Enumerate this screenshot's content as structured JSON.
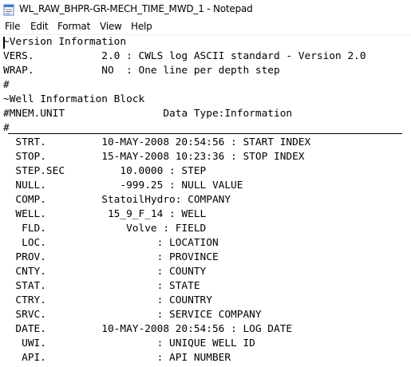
{
  "window": {
    "title": "WL_RAW_BHPR-GR-MECH_TIME_MWD_1 - Notepad",
    "icon": "notepad-icon"
  },
  "menu": {
    "file": "File",
    "edit": "Edit",
    "format": "Format",
    "view": "View",
    "help": "Help"
  },
  "document": {
    "lines": [
      "~Version Information",
      "VERS.           2.0 : CWLS log ASCII standard - Version 2.0",
      "WRAP.           NO  : One line per depth step",
      "#",
      "~Well Information Block",
      "#MNEM.UNIT                Data Type:Information",
      "#",
      "  STRT.         10-MAY-2008 20:54:56 : START INDEX",
      "  STOP.         15-MAY-2008 10:23:36 : STOP INDEX",
      "  STEP.SEC         10.0000 : STEP",
      "  NULL.            -999.25 : NULL VALUE",
      "  COMP.         StatoilHydro: COMPANY",
      "  WELL.          15_9_F_14 : WELL",
      "   FLD.             Volve : FIELD",
      "   LOC.                  : LOCATION",
      "  PROV.                  : PROVINCE",
      "  CNTY.                  : COUNTY",
      "  STAT.                  : STATE",
      "  CTRY.                  : COUNTRY",
      "  SRVC.                  : SERVICE COMPANY",
      "  DATE.         10-MAY-2008 20:54:56 : LOG DATE",
      "   UWI.                  : UNIQUE WELL ID",
      "   API.                  : API NUMBER"
    ]
  }
}
